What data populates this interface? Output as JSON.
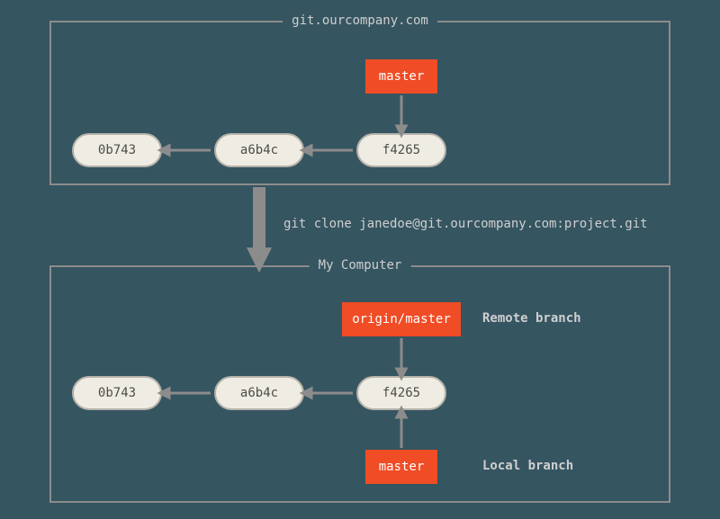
{
  "top_box": {
    "title": "git.ourcompany.com"
  },
  "bottom_box": {
    "title": "My Computer"
  },
  "commits_top": [
    "0b743",
    "a6b4c",
    "f4265"
  ],
  "commits_bottom": [
    "0b743",
    "a6b4c",
    "f4265"
  ],
  "branches": {
    "top_master": "master",
    "origin_master": "origin/master",
    "bottom_master": "master"
  },
  "labels": {
    "remote_branch": "Remote branch",
    "local_branch": "Local branch",
    "clone_cmd": "git clone janedoe@git.ourcompany.com:project.git"
  },
  "colors": {
    "bg": "#355561",
    "accent": "#f04c25",
    "commit_bg": "#efece3",
    "border": "#8c8c8c"
  }
}
